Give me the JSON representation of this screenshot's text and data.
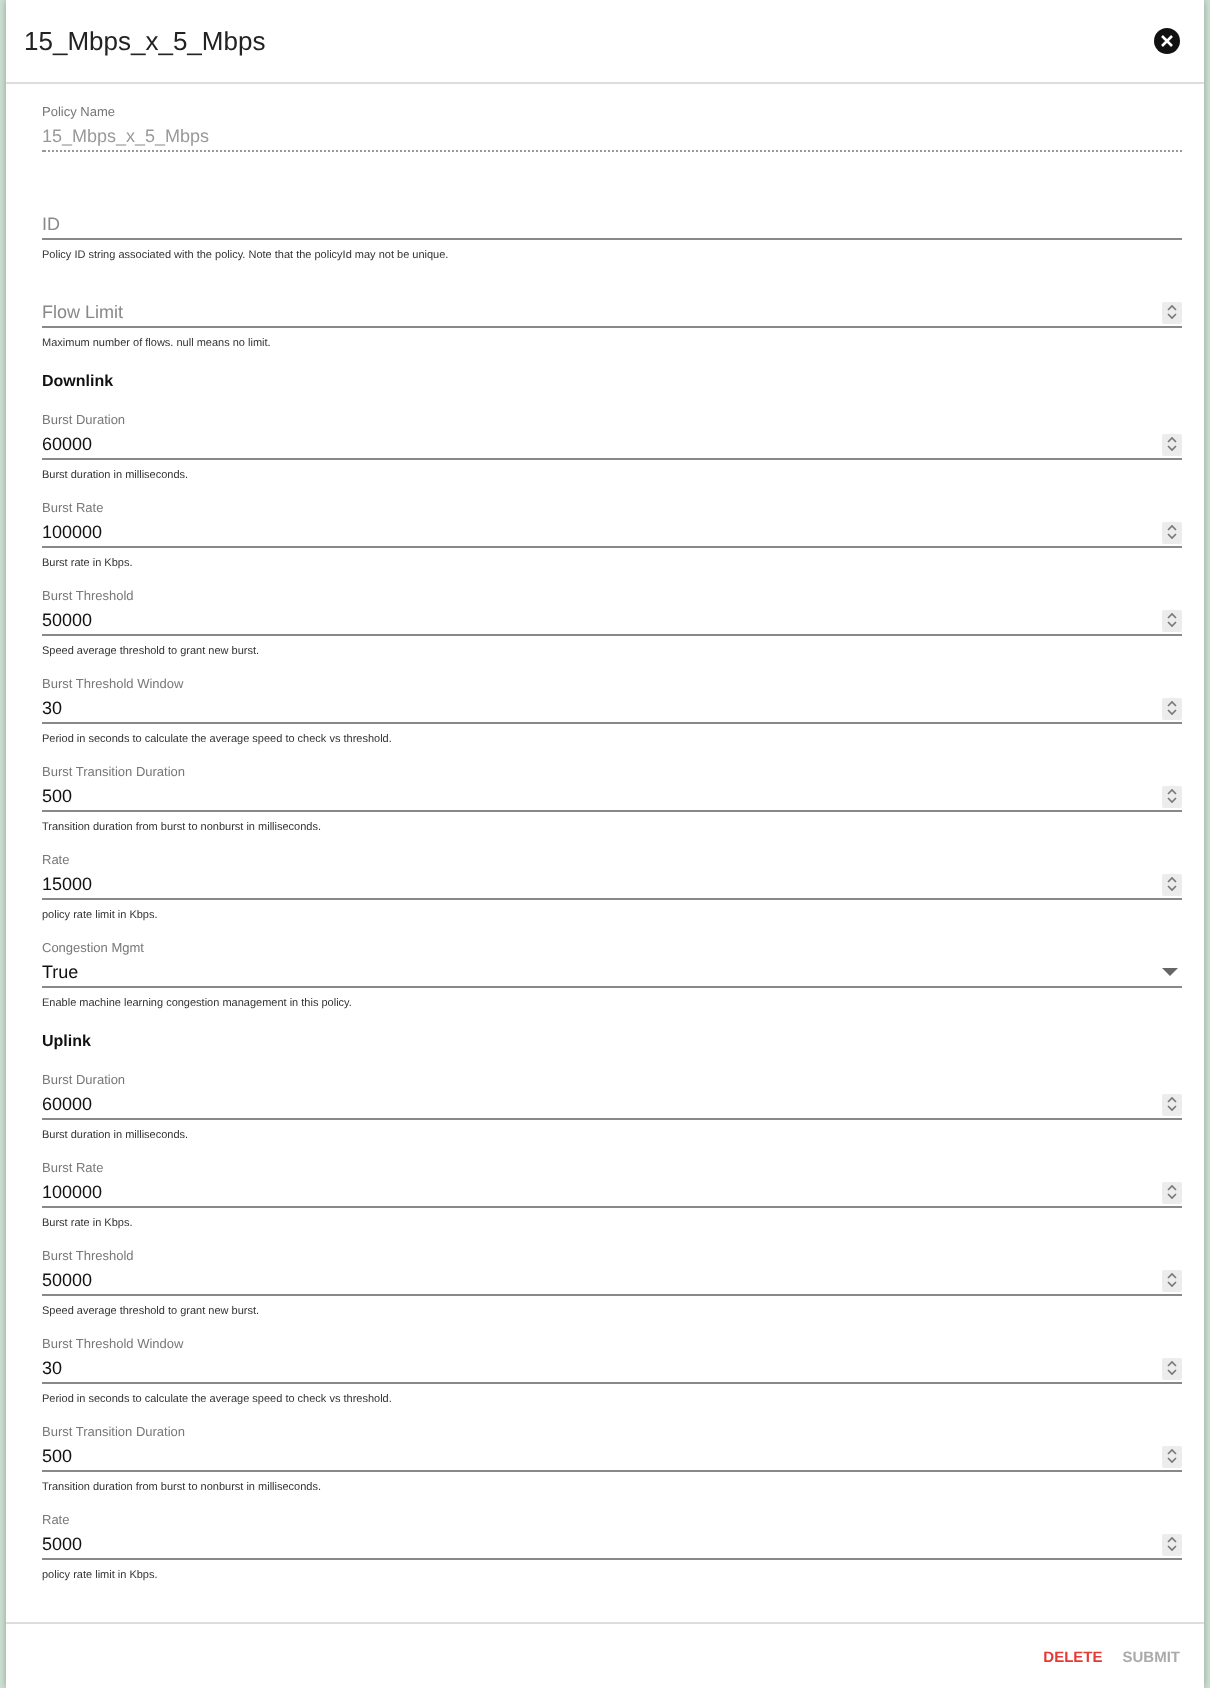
{
  "dialog": {
    "title": "15_Mbps_x_5_Mbps"
  },
  "fields": [
    {
      "kind": "text",
      "label": "Policy Name",
      "value": "15_Mbps_x_5_Mbps",
      "disabled": true
    },
    {
      "kind": "text",
      "placeholder": "ID",
      "helper": "Policy ID string associated with the policy. Note that the policyId may not be unique.",
      "disabled": false
    },
    {
      "kind": "number",
      "placeholder": "Flow Limit",
      "helper": "Maximum number of flows. null means no limit.",
      "disabled": false
    }
  ],
  "sections": [
    {
      "heading": "Downlink",
      "fields": [
        {
          "kind": "number",
          "label": "Burst Duration",
          "value": "60000",
          "helper": "Burst duration in milliseconds.",
          "disabled": false
        },
        {
          "kind": "number",
          "label": "Burst Rate",
          "value": "100000",
          "helper": "Burst rate in Kbps.",
          "disabled": false
        },
        {
          "kind": "number",
          "label": "Burst Threshold",
          "value": "50000",
          "helper": "Speed average threshold to grant new burst.",
          "disabled": false
        },
        {
          "kind": "number",
          "label": "Burst Threshold Window",
          "value": "30",
          "helper": "Period in seconds to calculate the average speed to check vs threshold.",
          "disabled": false
        },
        {
          "kind": "number",
          "label": "Burst Transition Duration",
          "value": "500",
          "helper": "Transition duration from burst to nonburst in milliseconds.",
          "disabled": false
        },
        {
          "kind": "number",
          "label": "Rate",
          "value": "15000",
          "helper": "policy rate limit in Kbps.",
          "disabled": false
        },
        {
          "kind": "select",
          "label": "Congestion Mgmt",
          "value": "True",
          "helper": "Enable machine learning congestion management in this policy.",
          "disabled": false
        }
      ]
    },
    {
      "heading": "Uplink",
      "fields": [
        {
          "kind": "number",
          "label": "Burst Duration",
          "value": "60000",
          "helper": "Burst duration in milliseconds.",
          "disabled": false
        },
        {
          "kind": "number",
          "label": "Burst Rate",
          "value": "100000",
          "helper": "Burst rate in Kbps.",
          "disabled": false
        },
        {
          "kind": "number",
          "label": "Burst Threshold",
          "value": "50000",
          "helper": "Speed average threshold to grant new burst.",
          "disabled": false
        },
        {
          "kind": "number",
          "label": "Burst Threshold Window",
          "value": "30",
          "helper": "Period in seconds to calculate the average speed to check vs threshold.",
          "disabled": false
        },
        {
          "kind": "number",
          "label": "Burst Transition Duration",
          "value": "500",
          "helper": "Transition duration from burst to nonburst in milliseconds.",
          "disabled": false
        },
        {
          "kind": "number",
          "label": "Rate",
          "value": "5000",
          "helper": "policy rate limit in Kbps.",
          "disabled": false
        }
      ]
    }
  ],
  "buttons": [
    {
      "label": "DELETE",
      "kind": "danger",
      "disabled": false
    },
    {
      "label": "SUBMIT",
      "kind": "primary",
      "disabled": true
    }
  ]
}
